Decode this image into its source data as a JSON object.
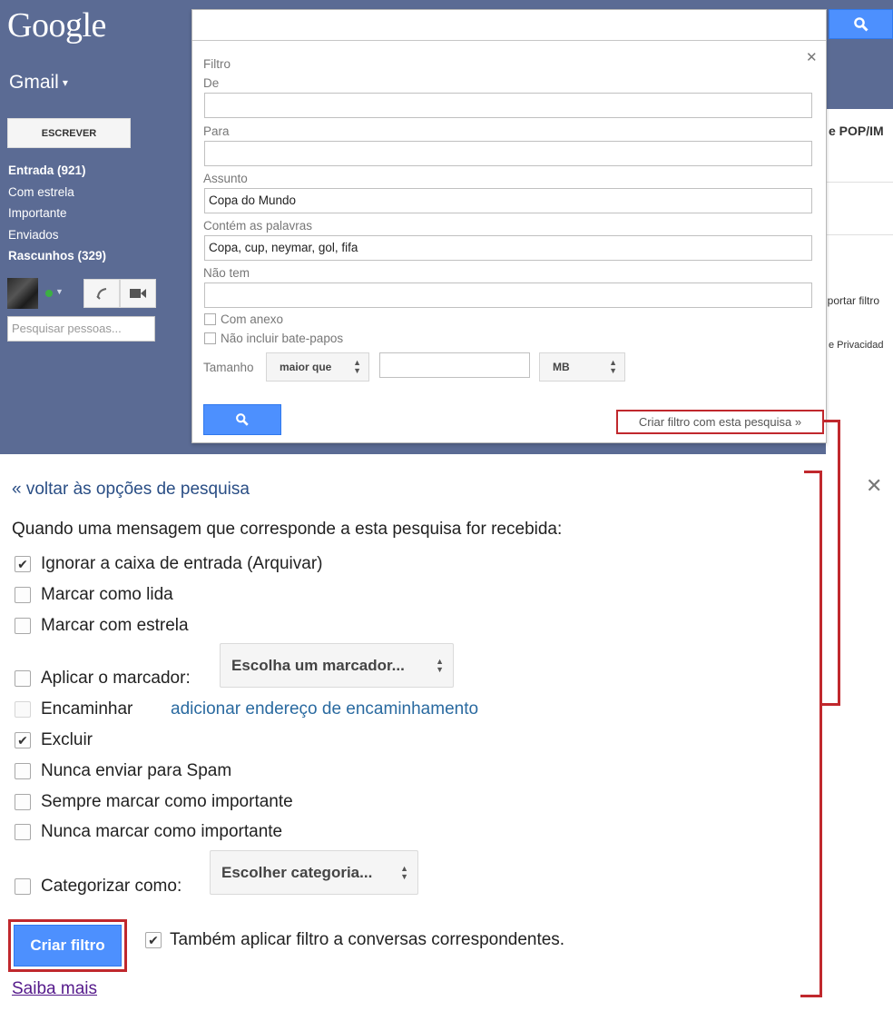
{
  "top": {
    "logo": "Google",
    "app_label": "Gmail",
    "write_button": "ESCREVER",
    "nav": [
      {
        "label": "Entrada (921)",
        "bold": true
      },
      {
        "label": "Com estrela",
        "bold": false
      },
      {
        "label": "Importante",
        "bold": false
      },
      {
        "label": "Enviados",
        "bold": false
      },
      {
        "label": "Rascunhos (329)",
        "bold": true
      }
    ],
    "people_search_placeholder": "Pesquisar pessoas...",
    "bg_text_pop": "e POP/IM",
    "bg_text_import": "iportar filtro",
    "bg_text_privacy": "e Privacidad"
  },
  "search_panel": {
    "title": "Filtro",
    "from_label": "De",
    "from_value": "",
    "to_label": "Para",
    "to_value": "",
    "subject_label": "Assunto",
    "subject_value": "Copa do Mundo",
    "has_words_label": "Contém as palavras",
    "has_words_value": "Copa, cup, neymar, gol, fifa",
    "doesnt_have_label": "Não tem",
    "doesnt_have_value": "",
    "has_attachment_label": "Com anexo",
    "no_chats_label": "Não incluir bate-papos",
    "size_label": "Tamanho",
    "size_operator": "maior que",
    "size_unit": "MB",
    "create_filter_link": "Criar filtro com esta pesquisa »"
  },
  "filter_options": {
    "back_link": "« voltar às opções de pesquisa",
    "intro": "Quando uma mensagem que corresponde a esta pesquisa for recebida:",
    "options": [
      {
        "label": "Ignorar a caixa de entrada (Arquivar)",
        "checked": true
      },
      {
        "label": "Marcar como lida",
        "checked": false
      },
      {
        "label": "Marcar com estrela",
        "checked": false
      },
      {
        "label": "Aplicar o marcador:",
        "checked": false
      },
      {
        "label": "Encaminhar",
        "checked": false,
        "disabled": true
      },
      {
        "label": "Excluir",
        "checked": true
      },
      {
        "label": "Nunca enviar para Spam",
        "checked": false
      },
      {
        "label": "Sempre marcar como importante",
        "checked": false
      },
      {
        "label": "Nunca marcar como importante",
        "checked": false
      },
      {
        "label": "Categorizar como:",
        "checked": false
      }
    ],
    "label_dropdown": "Escolha um marcador...",
    "forward_link": "adicionar endereço de encaminhamento",
    "category_dropdown": "Escolher categoria...",
    "create_button": "Criar filtro",
    "also_apply_label": "Também aplicar filtro a conversas correspondentes.",
    "also_apply_checked": true,
    "learn_more": "Saiba mais"
  },
  "colors": {
    "header_bg": "#5b6b94",
    "primary_button": "#4d90fe",
    "annotation_red": "#c0282d",
    "link": "#2a4e85"
  }
}
